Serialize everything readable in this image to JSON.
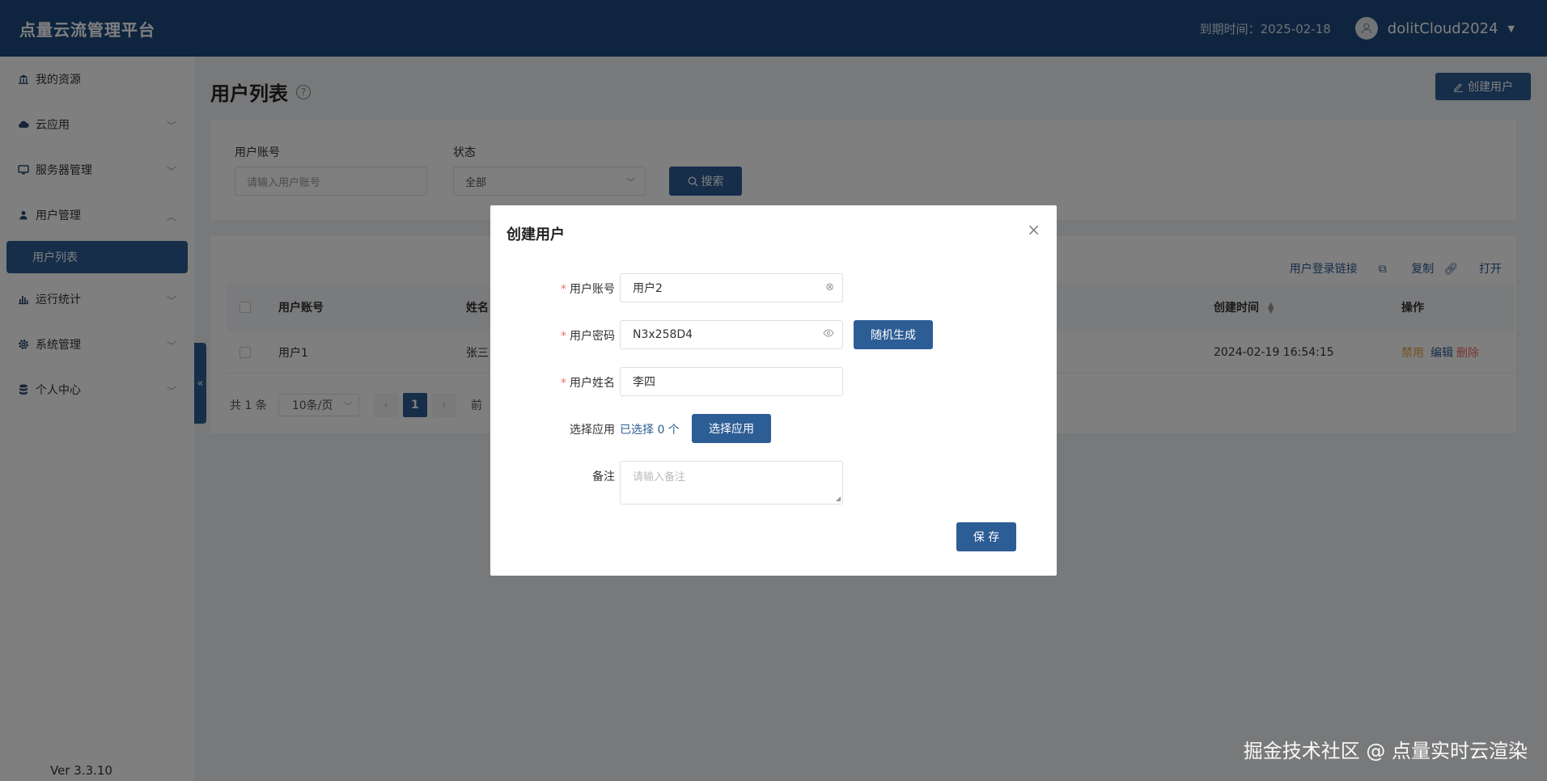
{
  "header": {
    "brand": "点量云流管理平台",
    "expire_text": "到期时间：2025-02-18",
    "username": "dolitCloud2024"
  },
  "sidebar": {
    "items": [
      {
        "label": "我的资源",
        "icon": "bank-icon"
      },
      {
        "label": "云应用",
        "icon": "cloud-icon"
      },
      {
        "label": "服务器管理",
        "icon": "monitor-icon"
      },
      {
        "label": "用户管理",
        "icon": "user-icon"
      },
      {
        "label": "运行统计",
        "icon": "bar-chart-icon"
      },
      {
        "label": "系统管理",
        "icon": "gear-icon"
      },
      {
        "label": "个人中心",
        "icon": "database-icon"
      }
    ],
    "active_sub": "用户列表",
    "version": "Ver 3.3.10"
  },
  "page": {
    "title": "用户列表",
    "create_btn": "创建用户"
  },
  "filter": {
    "account_label": "用户账号",
    "account_placeholder": "请输入用户账号",
    "status_label": "状态",
    "status_value": "全部",
    "search_btn": "搜索"
  },
  "table": {
    "links": {
      "login_link": "用户登录链接",
      "copy": "复制",
      "open": "打开"
    },
    "headers": {
      "account": "用户账号",
      "name": "姓名",
      "created": "创建时间",
      "action": "操作"
    },
    "rows": [
      {
        "account": "用户1",
        "name": "张三",
        "created": "2024-02-19 16:54:15"
      }
    ],
    "actions": {
      "disable": "禁用",
      "edit": "编辑",
      "delete": "删除"
    }
  },
  "pager": {
    "total": "共 1 条",
    "page_size": "10条/页",
    "current": "1",
    "goto_partial": "前"
  },
  "modal": {
    "title": "创建用户",
    "account_label": "用户账号",
    "account_value": "用户2",
    "password_label": "用户密码",
    "password_value": "N3x258D4",
    "random_btn": "随机生成",
    "name_label": "用户姓名",
    "name_value": "李四",
    "app_label": "选择应用",
    "app_selected": "已选择 0 个",
    "app_btn": "选择应用",
    "remark_label": "备注",
    "remark_placeholder": "请输入备注",
    "save_btn": "保 存"
  },
  "watermark": "掘金技术社区 @ 点量实时云渲染",
  "colors": {
    "primary": "#2d5d95",
    "header_bg": "#1e4a7e",
    "danger": "#f56c6c",
    "warning": "#e6a23c"
  }
}
